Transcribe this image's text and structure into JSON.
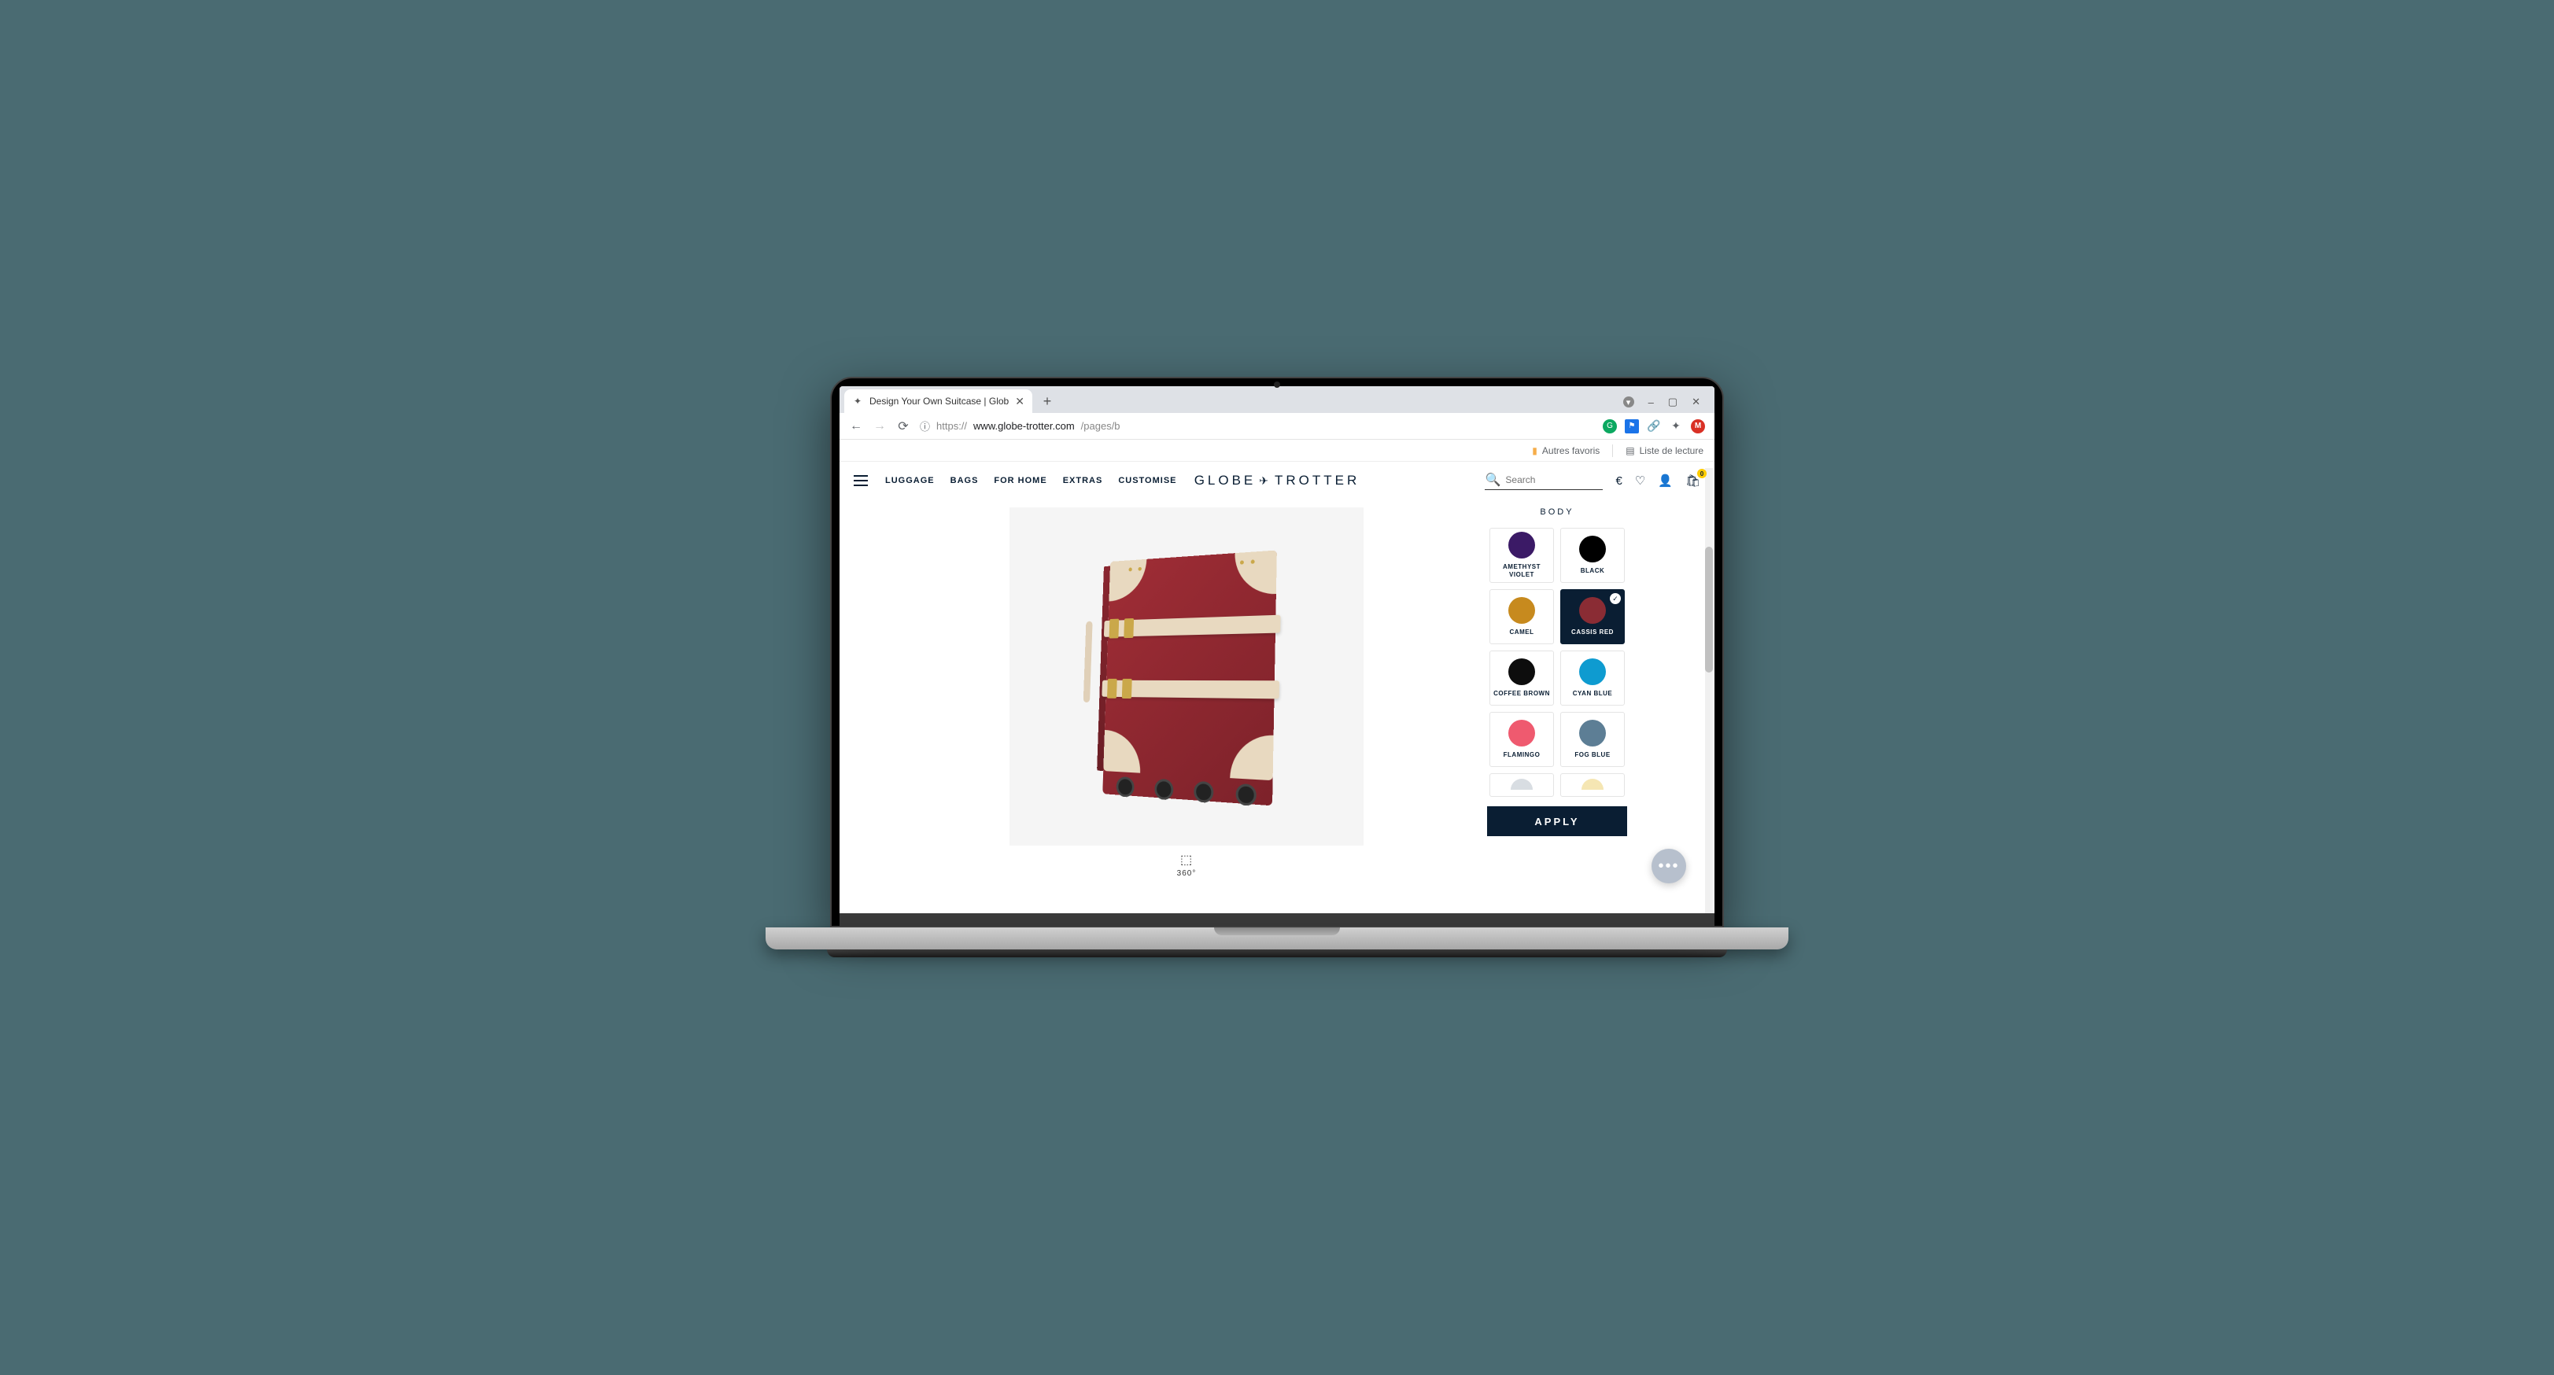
{
  "browser": {
    "tab_title": "Design Your Own Suitcase | Glob",
    "url_protocol": "https://",
    "url_host": "www.globe-trotter.com",
    "url_path": "/pages/b",
    "window_controls": {
      "minimize": "–",
      "maximize": "▢",
      "close": "✕"
    },
    "bookmarks": {
      "favorites": "Autres favoris",
      "reading_list": "Liste de lecture"
    },
    "ext_profile_letter": "M"
  },
  "header": {
    "nav": [
      "LUGGAGE",
      "BAGS",
      "FOR HOME",
      "EXTRAS",
      "CUSTOMISE"
    ],
    "brand_left": "GLOBE",
    "brand_right": "TROTTER",
    "search_placeholder": "Search",
    "bag_count": "0"
  },
  "configurator": {
    "section": "BODY",
    "swatches": [
      {
        "name": "AMETHYST VIOLET",
        "color": "#3b1a66",
        "selected": false
      },
      {
        "name": "BLACK",
        "color": "#000000",
        "selected": false
      },
      {
        "name": "CAMEL",
        "color": "#c78a1e",
        "selected": false
      },
      {
        "name": "CASSIS RED",
        "color": "#8a2c34",
        "selected": true
      },
      {
        "name": "COFFEE BROWN",
        "color": "#0d0d0d",
        "selected": false
      },
      {
        "name": "CYAN BLUE",
        "color": "#0e9bd0",
        "selected": false
      },
      {
        "name": "FLAMINGO",
        "color": "#ef5a6f",
        "selected": false
      },
      {
        "name": "FOG BLUE",
        "color": "#5d7e95",
        "selected": false
      }
    ],
    "peek_swatches": [
      {
        "color": "#d8dde2"
      },
      {
        "color": "#f5e6b3"
      }
    ],
    "apply_label": "APPLY",
    "rotate_label": "360°"
  }
}
